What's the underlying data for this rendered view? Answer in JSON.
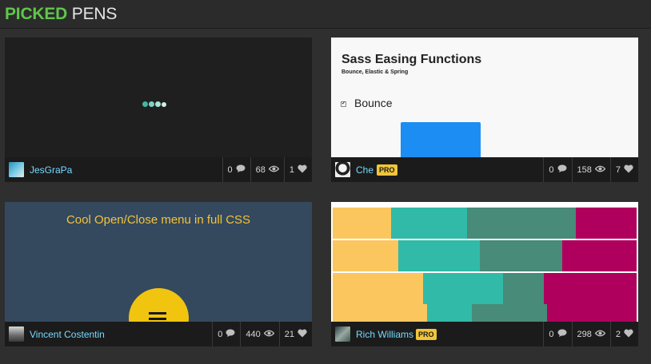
{
  "header": {
    "title_accent": "PICKED",
    "title_rest": "PENS"
  },
  "cards": [
    {
      "author": "JesGraPa",
      "pro": false,
      "comments": "0",
      "views": "68",
      "likes": "1",
      "preview": {
        "kind": "loader",
        "dot_colors": [
          "#3fb8a0",
          "#7fd3c3",
          "#a9e3d8",
          "#cfeee8"
        ]
      }
    },
    {
      "author": "Che",
      "pro": true,
      "pro_label": "PRO",
      "comments": "0",
      "views": "158",
      "likes": "7",
      "preview": {
        "kind": "sass",
        "title": "Sass Easing Functions",
        "subtitle": "Bounce, Elastic & Spring",
        "option_label": "Bounce",
        "checkbox_mark": "✔",
        "box_color": "#1c8ef3"
      }
    },
    {
      "author": "Vincent Costentin",
      "pro": false,
      "comments": "0",
      "views": "440",
      "likes": "21",
      "preview": {
        "kind": "menu",
        "title": "Cool Open/Close menu in full CSS",
        "bg": "#34495e",
        "accent": "#f1c40f"
      }
    },
    {
      "author": "Rich Williams",
      "pro": true,
      "pro_label": "PRO",
      "comments": "0",
      "views": "298",
      "likes": "2",
      "preview": {
        "kind": "bands",
        "colors": [
          "#fcc65f",
          "#31baa8",
          "#478b78",
          "#b0005e"
        ]
      }
    }
  ],
  "colors": {
    "accent_green": "#5fc64a",
    "link_blue": "#76daff",
    "pro_yellow": "#f0c53a"
  }
}
